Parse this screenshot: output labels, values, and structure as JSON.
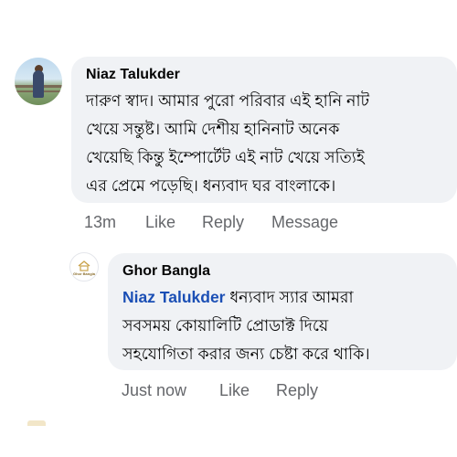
{
  "comments": [
    {
      "author": "Niaz Talukder",
      "lines": [
        "দারুণ স্বাদ। আমার পুরো পরিবার এই হানি নাট",
        "খেয়ে সন্তুষ্ট।  আমি দেশীয় হানিনাট অনেক",
        "খেয়েছি কিন্তু ইম্পোর্টেট এই নাট খেয়ে সত্যিই",
        "এর প্রেমে পড়েছি।  ধন্যবাদ ঘর বাংলাকে।"
      ],
      "time": "13m",
      "actions": [
        "Like",
        "Reply",
        "Message"
      ]
    }
  ],
  "reply": {
    "author": "Ghor Bangla",
    "brand_mark": "Ghor Bangla",
    "mention": "Niaz Talukder",
    "line1_rest": " ধন্যবাদ স্যার আমরা",
    "lines": [
      "সবসময় কোয়ালিটি প্রোডাক্ট দিয়ে",
      "সহযোগিতা করার জন্য চেষ্টা করে থাকি।"
    ],
    "time": "Just now",
    "actions": [
      "Like",
      "Reply"
    ]
  }
}
